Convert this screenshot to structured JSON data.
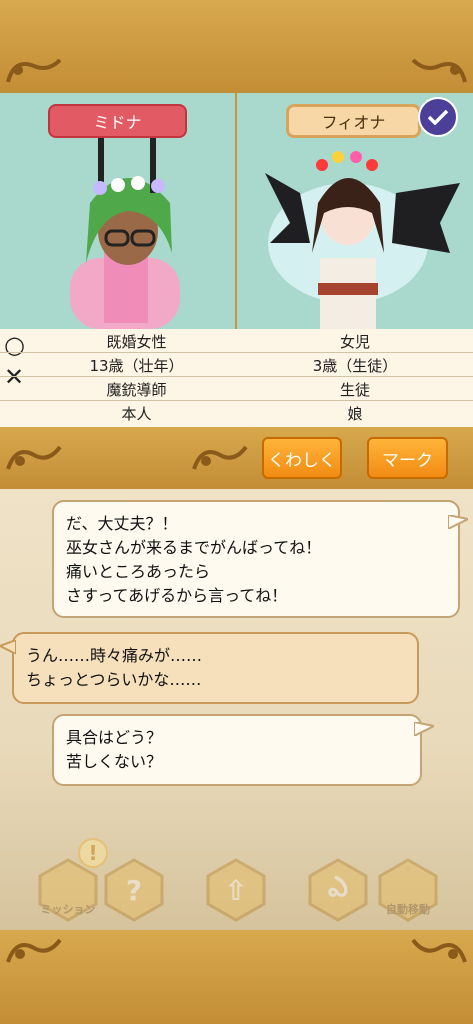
{
  "characters": {
    "left": {
      "name": "ミドナ",
      "marital": "既婚女性",
      "age": "13歳（壮年）",
      "job": "魔銃導師",
      "relation": "本人"
    },
    "right": {
      "name": "フィオナ",
      "marital": "女児",
      "age": "3歳（生徒）",
      "job": "生徒",
      "relation": "娘"
    }
  },
  "markers": {
    "ok": "○",
    "ng": "✕"
  },
  "buttons": {
    "detail": "くわしく",
    "mark": "マーク"
  },
  "messages": [
    {
      "text": "だ、大丈夫？！\n巫女さんが来るまでがんばってね！\n痛いところあったら\nさすってあげるから言ってね！"
    },
    {
      "text": "うん……時々痛みが……\nちょっとつらいかな……"
    },
    {
      "text": "具合はどう？\n苦しくない？"
    }
  ],
  "bottom_menu": {
    "item1_label": "ミッション",
    "item2_glyph": "?",
    "item3_glyph": "⇧",
    "item4_glyph": "ఎ",
    "item5_label": "自動移動",
    "alert_glyph": "!"
  },
  "colors": {
    "frame_gold": "#c9963f",
    "portrait_bg": "#a9d8cc",
    "badge_left": "#e25a63",
    "badge_right": "#f6d7a5",
    "button_orange": "#f28b12",
    "check_purple": "#4b3f9a"
  },
  "icons": [
    "checkmark-icon",
    "ring-icon",
    "cross-icon",
    "question-icon",
    "arrow-up-icon",
    "swirl-icon"
  ]
}
